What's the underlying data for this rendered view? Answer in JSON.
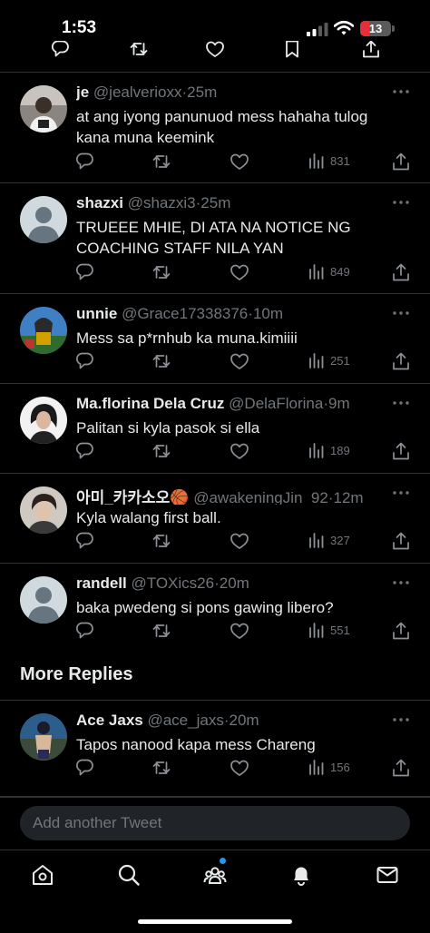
{
  "status_bar": {
    "time": "1:53",
    "battery": "13"
  },
  "tweets": [
    {
      "name": "je",
      "handle": "@jealverioxx",
      "time": "25m",
      "text": "at ang iyong panunuod mess hahaha tulog kana muna keemink",
      "views": "831"
    },
    {
      "name": "shazxi",
      "handle": "@shazxi3",
      "time": "25m",
      "text": "TRUEEE MHIE, DI ATA NA NOTICE NG COACHING STAFF NILA YAN",
      "views": "849"
    },
    {
      "name": "unnie",
      "handle": "@Grace17338376",
      "time": "10m",
      "text": "Mess sa p*rnhub ka muna.kimiiii",
      "views": "251"
    },
    {
      "name": "Ma.florina Dela Cruz",
      "handle": "@DelaFlorina",
      "time": "9m",
      "text": "Palitan si kyla pasok si ella",
      "views": "189"
    },
    {
      "name": "아미_카카소오🏀",
      "handle": "@awakeningJin_92",
      "time": "12m",
      "text": "Kyla walang first ball.",
      "views": "327"
    },
    {
      "name": "randell",
      "handle": "@TOXics26",
      "time": "20m",
      "text": "baka pwedeng si pons gawing libero?",
      "views": "551"
    },
    {
      "name": "Ace Jaxs",
      "handle": "@ace_jaxs",
      "time": "20m",
      "text": "Tapos nanood kapa mess Chareng",
      "views": "156"
    }
  ],
  "sep": "·",
  "more_replies_label": "More Replies",
  "reply_placeholder": "Add another Tweet",
  "icons": {
    "reply": "speech-bubble-icon",
    "retweet": "retweet-icon",
    "like": "heart-icon",
    "views": "bar-chart-icon",
    "share": "share-icon",
    "more": "ellipsis-icon"
  },
  "nav": [
    "home-icon",
    "search-icon",
    "communities-icon",
    "notifications-icon",
    "messages-icon"
  ],
  "colors": {
    "background": "#000000",
    "text": "#e7e9ea",
    "muted": "#71767b",
    "accent": "#1d9bf0",
    "battery": "#e5303a"
  }
}
